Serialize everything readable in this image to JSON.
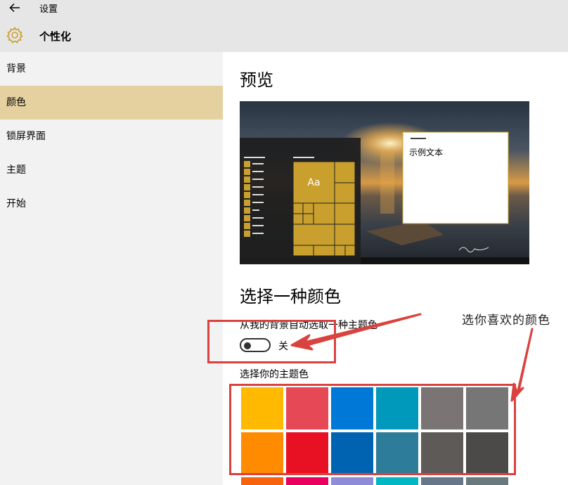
{
  "window": {
    "title": "设置"
  },
  "header": {
    "page_title": "个性化"
  },
  "sidebar": {
    "items": [
      {
        "label": "背景"
      },
      {
        "label": "颜色"
      },
      {
        "label": "锁屏界面"
      },
      {
        "label": "主题"
      },
      {
        "label": "开始"
      }
    ],
    "selected": "颜色"
  },
  "preview": {
    "heading": "预览",
    "tile_label": "Aa",
    "sample_text": "示例文本"
  },
  "color_section": {
    "heading": "选择一种颜色",
    "auto_pick_label": "从我的背景自动选取一种主题色",
    "toggle_state": "关",
    "accent_label": "选择你的主题色"
  },
  "annotation": {
    "callout_text": "选你喜欢的颜色"
  },
  "colors": {
    "accent": "#c9a02e",
    "selected_nav": "#e5d19f",
    "annotation_red": "#d9423e",
    "swatches": [
      "#ffb900",
      "#e74856",
      "#0078d7",
      "#0099bc",
      "#7a7574",
      "#767676",
      "#ff8c00",
      "#e81123",
      "#0063b1",
      "#2d7d9a",
      "#5d5a58",
      "#4c4a48",
      "#f7630c",
      "#ea005e",
      "#8e8cd8",
      "#00b7c3",
      "#68768a",
      "#69797e"
    ]
  },
  "icons": {
    "back": "arrow-left-icon",
    "settings": "gear-icon"
  }
}
